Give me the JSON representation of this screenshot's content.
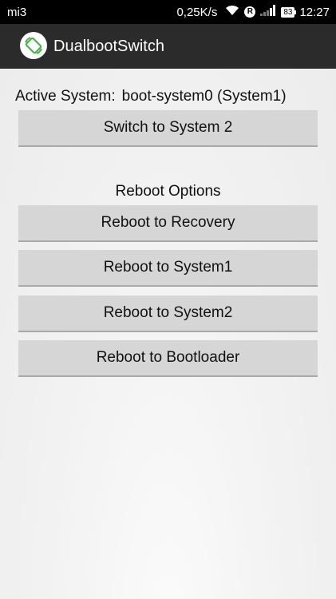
{
  "status_bar": {
    "carrier": "mi3",
    "net_speed": "0,25K/s",
    "roaming_badge": "R",
    "battery_level": "83",
    "time": "12:27",
    "icons": [
      "wifi-icon",
      "roaming-icon",
      "signal-icon",
      "battery-icon"
    ]
  },
  "action_bar": {
    "app_title": "DualbootSwitch",
    "app_icon": "rotate-phone-icon",
    "brand_color": "#2b2b2b",
    "icon_accent": "#4caf50"
  },
  "main": {
    "active_label": "Active System:",
    "active_value": "boot-system0 (System1)",
    "switch_button": "Switch to System 2",
    "reboot_title": "Reboot Options",
    "reboot_buttons": [
      "Reboot to Recovery",
      "Reboot to System1",
      "Reboot to System2",
      "Reboot to Bootloader"
    ]
  }
}
